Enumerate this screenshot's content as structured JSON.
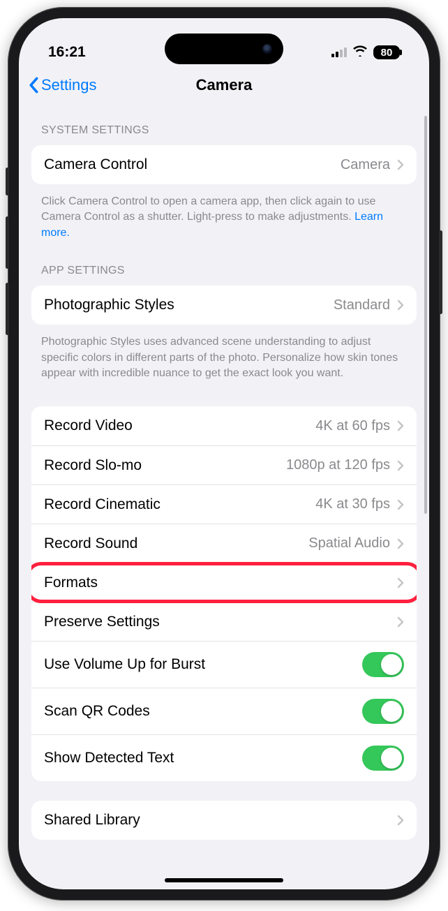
{
  "status": {
    "time": "16:21",
    "battery": "80"
  },
  "nav": {
    "back": "Settings",
    "title": "Camera"
  },
  "sections": {
    "s1": {
      "header": "SYSTEM SETTINGS",
      "rows": {
        "camera_control": {
          "label": "Camera Control",
          "value": "Camera"
        }
      },
      "footer": "Click Camera Control to open a camera app, then click again to use Camera Control as a shutter. Light-press to make adjustments. ",
      "footer_link": "Learn more."
    },
    "s2": {
      "header": "APP SETTINGS",
      "rows": {
        "styles": {
          "label": "Photographic Styles",
          "value": "Standard"
        }
      },
      "footer": "Photographic Styles uses advanced scene understanding to adjust specific colors in different parts of the photo. Personalize how skin tones appear with incredible nuance to get the exact look you want."
    },
    "s3": {
      "rows": {
        "video": {
          "label": "Record Video",
          "value": "4K at 60 fps"
        },
        "slomo": {
          "label": "Record Slo-mo",
          "value": "1080p at 120 fps"
        },
        "cinematic": {
          "label": "Record Cinematic",
          "value": "4K at 30 fps"
        },
        "sound": {
          "label": "Record Sound",
          "value": "Spatial Audio"
        },
        "formats": {
          "label": "Formats"
        },
        "preserve": {
          "label": "Preserve Settings"
        },
        "burst": {
          "label": "Use Volume Up for Burst",
          "on": true
        },
        "qr": {
          "label": "Scan QR Codes",
          "on": true
        },
        "text": {
          "label": "Show Detected Text",
          "on": true
        }
      }
    },
    "s4": {
      "rows": {
        "shared": {
          "label": "Shared Library"
        }
      }
    }
  }
}
